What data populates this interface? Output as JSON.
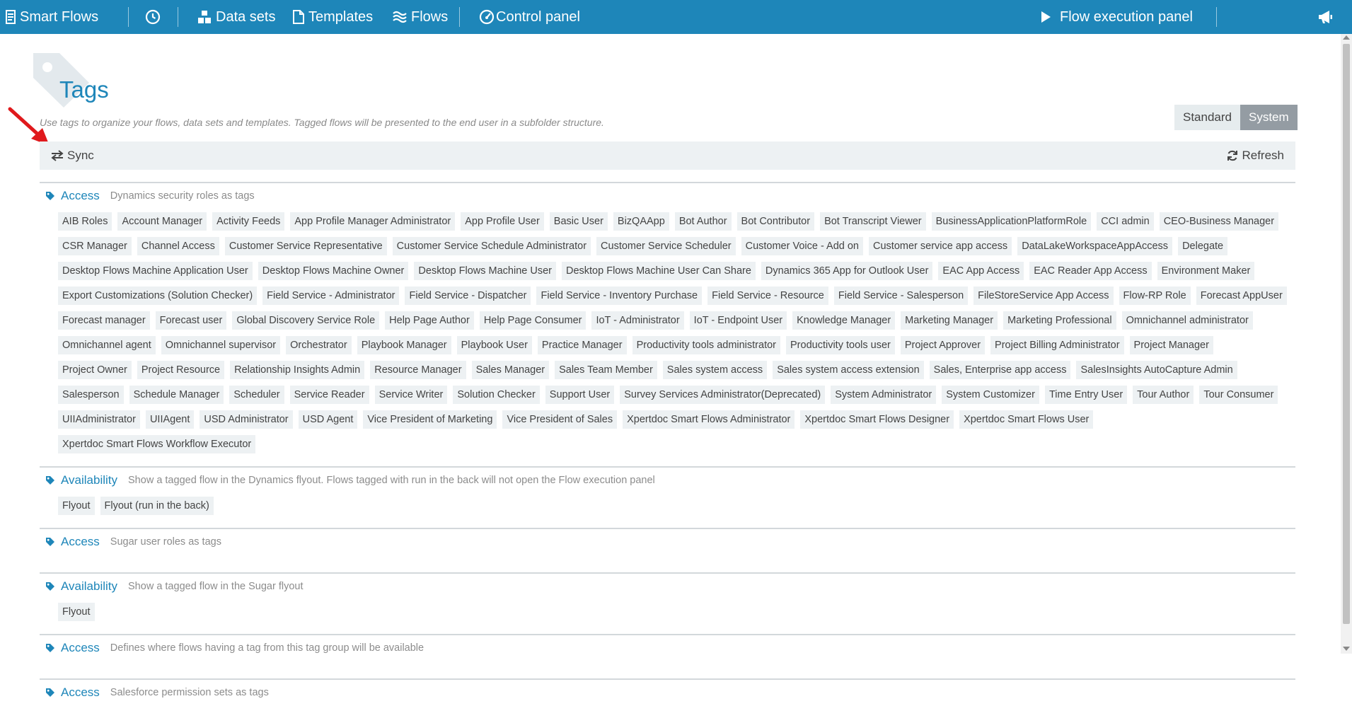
{
  "nav": {
    "brand": "Smart Flows",
    "datasets": "Data sets",
    "templates": "Templates",
    "flows": "Flows",
    "control_panel": "Control panel",
    "flow_execution_panel": "Flow execution panel"
  },
  "page": {
    "title": "Tags",
    "subtitle": "Use tags to organize your flows, data sets and templates. Tagged flows will be presented to the end user in a subfolder structure.",
    "toggle_standard": "Standard",
    "toggle_system": "System",
    "sync_label": "Sync",
    "refresh_label": "Refresh"
  },
  "groups": [
    {
      "name": "Access",
      "description": "Dynamics security roles as tags",
      "tags": [
        "AIB Roles",
        "Account Manager",
        "Activity Feeds",
        "App Profile Manager Administrator",
        "App Profile User",
        "Basic User",
        "BizQAApp",
        "Bot Author",
        "Bot Contributor",
        "Bot Transcript Viewer",
        "BusinessApplicationPlatformRole",
        "CCI admin",
        "CEO-Business Manager",
        "CSR Manager",
        "Channel Access",
        "Customer Service Representative",
        "Customer Service Schedule Administrator",
        "Customer Service Scheduler",
        "Customer Voice - Add on",
        "Customer service app access",
        "DataLakeWorkspaceAppAccess",
        "Delegate",
        "Desktop Flows Machine Application User",
        "Desktop Flows Machine Owner",
        "Desktop Flows Machine User",
        "Desktop Flows Machine User Can Share",
        "Dynamics 365 App for Outlook User",
        "EAC App Access",
        "EAC Reader App Access",
        "Environment Maker",
        "Export Customizations (Solution Checker)",
        "Field Service - Administrator",
        "Field Service - Dispatcher",
        "Field Service - Inventory Purchase",
        "Field Service - Resource",
        "Field Service - Salesperson",
        "FileStoreService App Access",
        "Flow-RP Role",
        "Forecast AppUser",
        "Forecast manager",
        "Forecast user",
        "Global Discovery Service Role",
        "Help Page Author",
        "Help Page Consumer",
        "IoT - Administrator",
        "IoT - Endpoint User",
        "Knowledge Manager",
        "Marketing Manager",
        "Marketing Professional",
        "Omnichannel administrator",
        "Omnichannel agent",
        "Omnichannel supervisor",
        "Orchestrator",
        "Playbook Manager",
        "Playbook User",
        "Practice Manager",
        "Productivity tools administrator",
        "Productivity tools user",
        "Project Approver",
        "Project Billing Administrator",
        "Project Manager",
        "Project Owner",
        "Project Resource",
        "Relationship Insights Admin",
        "Resource Manager",
        "Sales Manager",
        "Sales Team Member",
        "Sales system access",
        "Sales system access extension",
        "Sales, Enterprise app access",
        "SalesInsights AutoCapture Admin",
        "Salesperson",
        "Schedule Manager",
        "Scheduler",
        "Service Reader",
        "Service Writer",
        "Solution Checker",
        "Support User",
        "Survey Services Administrator(Deprecated)",
        "System Administrator",
        "System Customizer",
        "Time Entry User",
        "Tour Author",
        "Tour Consumer",
        "UIIAdministrator",
        "UIIAgent",
        "USD Administrator",
        "USD Agent",
        "Vice President of Marketing",
        "Vice President of Sales",
        "Xpertdoc Smart Flows Administrator",
        "Xpertdoc Smart Flows Designer",
        "Xpertdoc Smart Flows User",
        "Xpertdoc Smart Flows Workflow Executor"
      ]
    },
    {
      "name": "Availability",
      "description": "Show a tagged flow in the Dynamics flyout. Flows tagged with run in the back will not open the Flow execution panel",
      "tags": [
        "Flyout",
        "Flyout (run in the back)"
      ]
    },
    {
      "name": "Access",
      "description": "Sugar user roles as tags",
      "tags": []
    },
    {
      "name": "Availability",
      "description": "Show a tagged flow in the Sugar flyout",
      "tags": [
        "Flyout"
      ]
    },
    {
      "name": "Access",
      "description": "Defines where flows having a tag from this tag group will be available",
      "tags": []
    },
    {
      "name": "Access",
      "description": "Salesforce permission sets as tags",
      "tags": []
    }
  ],
  "colors": {
    "accent": "#1e86b9",
    "tag_bg": "#edf1f3",
    "toggle_active": "#949ca3",
    "arrow": "#e0191c"
  },
  "icons": [
    "smart-flows-logo-icon",
    "history-icon",
    "datasets-icon",
    "templates-icon",
    "flows-icon",
    "dashboard-icon",
    "play-icon",
    "megaphone-icon",
    "tag-icon",
    "sync-icon",
    "refresh-icon"
  ]
}
